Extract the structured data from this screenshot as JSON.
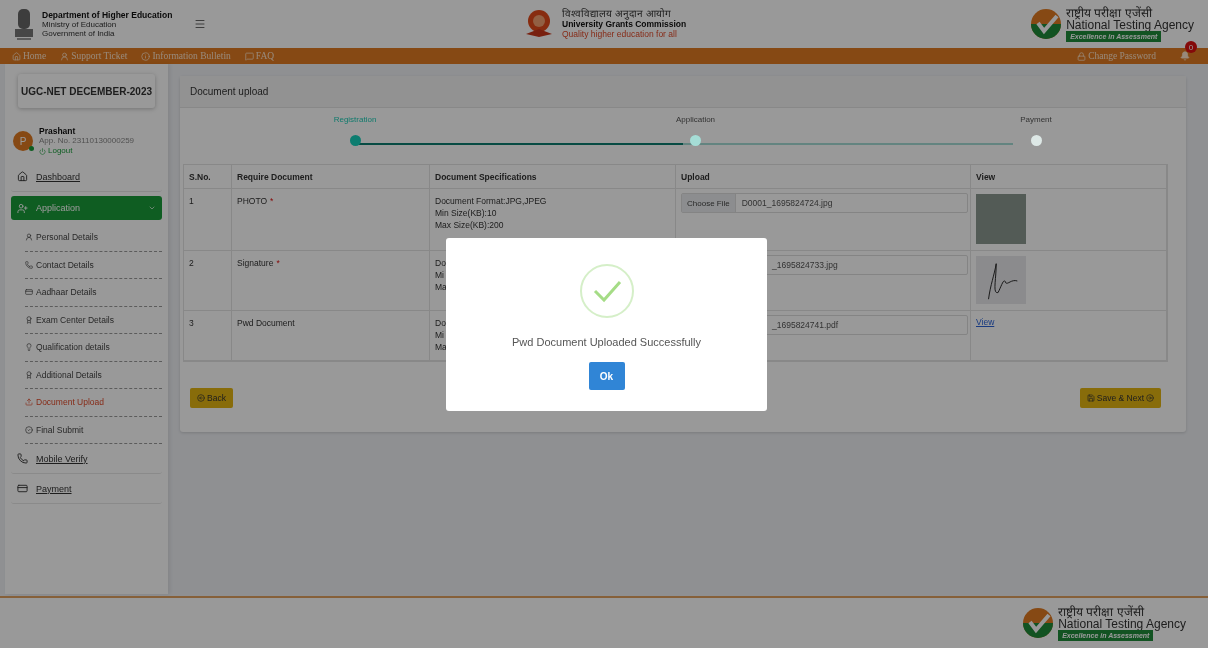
{
  "header": {
    "dept": {
      "title": "Department of Higher Education",
      "lines": [
        "Ministry of Education",
        "Government of India"
      ]
    },
    "ugc": {
      "hindi": "विश्वविद्यालय अनुदान आयोग",
      "name": "University Grants Commission",
      "tagline": "Quality higher education for all"
    },
    "nta": {
      "hindi": "राष्ट्रीय परीक्षा एजेंसी",
      "name": "National Testing Agency",
      "tagline": "Excellence in Assessment"
    }
  },
  "nav": {
    "links": [
      {
        "label": "Home"
      },
      {
        "label": "Support Ticket"
      },
      {
        "label": "Information Bulletin"
      },
      {
        "label": "FAQ"
      }
    ],
    "change_password": "Change Password",
    "notifications": "0"
  },
  "sidebar": {
    "exam": "UGC-NET DECEMBER-2023",
    "user": {
      "initial": "P",
      "name": "Prashant",
      "app_no": "App. No. 231101300002​59",
      "logout": "Logout",
      "online": true
    },
    "items": [
      {
        "label": "Dashboard",
        "selected": false
      },
      {
        "label": "Application",
        "selected": true,
        "expanded": true,
        "children": [
          {
            "label": "Personal Details",
            "selected": false
          },
          {
            "label": "Contact Details",
            "selected": false
          },
          {
            "label": "Aadhaar Details",
            "selected": false
          },
          {
            "label": "Exam Center Details",
            "selected": false
          },
          {
            "label": "Qualification details",
            "selected": false
          },
          {
            "label": "Additional Details",
            "selected": false
          },
          {
            "label": "Document Upload",
            "selected": true
          },
          {
            "label": "Final Submit",
            "selected": false
          }
        ]
      },
      {
        "label": "Mobile Verify",
        "selected": false
      },
      {
        "label": "Payment",
        "selected": false
      }
    ]
  },
  "main": {
    "title": "Document upload",
    "steps": [
      {
        "label": "Registration",
        "kind": "done"
      },
      {
        "label": "Application",
        "kind": "active"
      },
      {
        "label": "Payment",
        "kind": "pending"
      }
    ],
    "table": {
      "columns": [
        "S.No.",
        "Require Document",
        "Document Specifications",
        "Upload",
        "View"
      ],
      "rows": [
        {
          "sno": "1",
          "document": "PHOTO",
          "mark": "*",
          "specs": [
            "Document Format:JPG,JPEG",
            "Min Size(KB):10",
            "Max Size(KB):200"
          ],
          "choose": "Choose File",
          "file": "D0001_1695824724.jpg",
          "kind": "photo"
        },
        {
          "sno": "2",
          "document": "Signature",
          "mark": "*",
          "specs": [
            "Do",
            "Mi",
            "Ma"
          ],
          "file": "_1695824733.jpg",
          "kind": "signature"
        },
        {
          "sno": "3",
          "document": "Pwd Document",
          "specs": [
            "Do",
            "Mi",
            "Ma"
          ],
          "file": "_1695824741.pdf",
          "kind": "link",
          "view_label": "View"
        }
      ]
    },
    "back": "Back",
    "save": "Save & Next"
  },
  "footer": {
    "nta": {
      "hindi": "राष्ट्रीय परीक्षा एजेंसी",
      "name": "National Testing Agency",
      "tagline": "Excellence in Assessment"
    }
  },
  "modal": {
    "message": "Pwd Document Uploaded Successfully",
    "ok": "Ok"
  }
}
